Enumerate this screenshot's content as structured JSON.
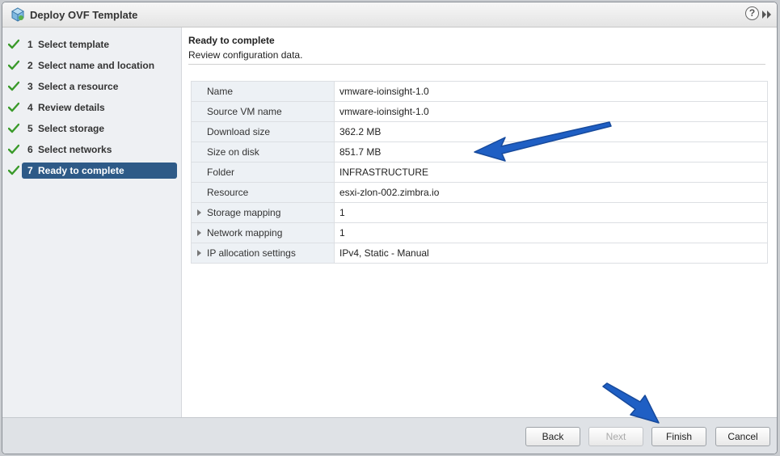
{
  "window": {
    "title": "Deploy OVF Template",
    "help_glyph": "?"
  },
  "steps": [
    {
      "num": "1",
      "label": "Select template",
      "done": true
    },
    {
      "num": "2",
      "label": "Select name and location",
      "done": true
    },
    {
      "num": "3",
      "label": "Select a resource",
      "done": true
    },
    {
      "num": "4",
      "label": "Review details",
      "done": true
    },
    {
      "num": "5",
      "label": "Select storage",
      "done": true
    },
    {
      "num": "6",
      "label": "Select networks",
      "done": true
    },
    {
      "num": "7",
      "label": "Ready to complete",
      "done": true,
      "active": true
    }
  ],
  "main": {
    "title": "Ready to complete",
    "subtitle": "Review configuration data."
  },
  "config_rows": [
    {
      "key": "Name",
      "value": "vmware-ioinsight-1.0",
      "expandable": false
    },
    {
      "key": "Source VM name",
      "value": "vmware-ioinsight-1.0",
      "expandable": false
    },
    {
      "key": "Download size",
      "value": "362.2 MB",
      "expandable": false
    },
    {
      "key": "Size on disk",
      "value": "851.7 MB",
      "expandable": false
    },
    {
      "key": "Folder",
      "value": "INFRASTRUCTURE",
      "expandable": false
    },
    {
      "key": "Resource",
      "value": "esxi-zlon-002.zimbra.io",
      "expandable": false
    },
    {
      "key": "Storage mapping",
      "value": "1",
      "expandable": true
    },
    {
      "key": "Network mapping",
      "value": "1",
      "expandable": true
    },
    {
      "key": "IP allocation settings",
      "value": "IPv4, Static - Manual",
      "expandable": true
    }
  ],
  "footer": {
    "back_label": "Back",
    "next_label": "Next",
    "finish_label": "Finish",
    "cancel_label": "Cancel"
  },
  "colors": {
    "active_step": "#2e5a87",
    "check": "#3a9a2a",
    "annotation_arrow": "#1f5fc4"
  }
}
